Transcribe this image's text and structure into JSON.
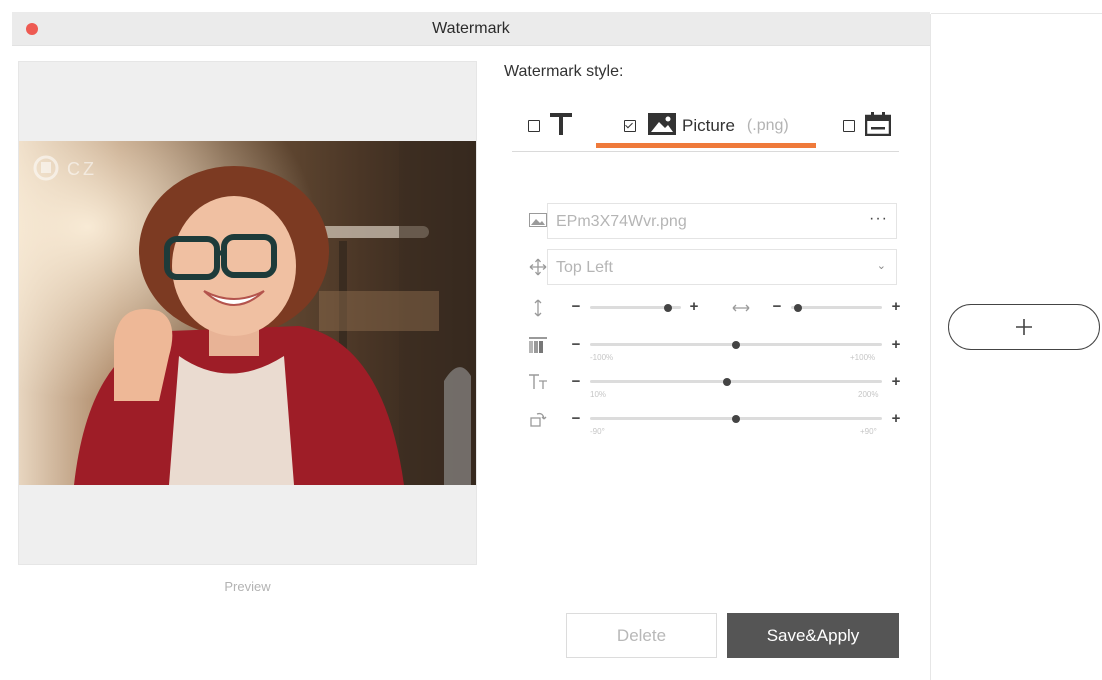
{
  "window": {
    "title": "Watermark"
  },
  "preview": {
    "label": "Preview",
    "watermark_text": "CZ"
  },
  "style": {
    "label": "Watermark style:",
    "tabs": [
      {
        "icon": "text-T-icon",
        "checked": false
      },
      {
        "icon": "picture-icon",
        "label": "Picture",
        "ext": "(.png)",
        "checked": true,
        "active": true
      },
      {
        "icon": "calendar-icon",
        "checked": false
      }
    ]
  },
  "picture_field": {
    "value": "EPm3X74Wvr.png",
    "more": "···"
  },
  "position_select": {
    "value": "Top Left"
  },
  "sliders": {
    "vertical_offset": {
      "level": 0.86
    },
    "horizontal_offset": {
      "level": 0.08
    },
    "opacity": {
      "min_label": "-100%",
      "max_label": "+100%",
      "level": 0.5
    },
    "size": {
      "min_label": "10%",
      "max_label": "200%",
      "level": 0.47
    },
    "rotation": {
      "min_label": "-90°",
      "max_label": "+90°",
      "level": 0.5
    }
  },
  "buttons": {
    "delete": "Delete",
    "save_apply": "Save&Apply",
    "add": "+"
  },
  "colors": {
    "accent": "#ef7a3b",
    "close": "#ee5a52",
    "save_bg": "#555555"
  }
}
